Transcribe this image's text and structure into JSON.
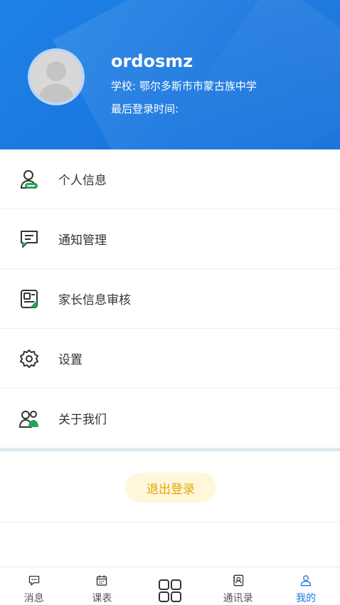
{
  "profile": {
    "username": "ordosmz",
    "school": "学校: 鄂尔多斯市市蒙古族中学",
    "last_login": "最后登录时间:"
  },
  "menu": {
    "items": [
      {
        "label": "个人信息",
        "icon": "user-card-icon"
      },
      {
        "label": "通知管理",
        "icon": "message-bubble-icon"
      },
      {
        "label": "家长信息审核",
        "icon": "id-card-icon"
      },
      {
        "label": "设置",
        "icon": "gear-icon"
      },
      {
        "label": "关于我们",
        "icon": "people-icon"
      }
    ]
  },
  "logout": {
    "label": "退出登录"
  },
  "tabbar": {
    "tabs": [
      {
        "label": "消息",
        "icon": "chat-icon"
      },
      {
        "label": "课表",
        "icon": "calendar-icon"
      },
      {
        "label": "",
        "icon": "grid-icon"
      },
      {
        "label": "通讯录",
        "icon": "contacts-icon"
      },
      {
        "label": "我的",
        "icon": "user-icon"
      }
    ],
    "active_index": 4
  },
  "colors": {
    "brand_blue": "#1a78e0",
    "accent_green": "#2aa35a",
    "logout_text": "#e0a800",
    "logout_bg": "#fff6dc"
  }
}
